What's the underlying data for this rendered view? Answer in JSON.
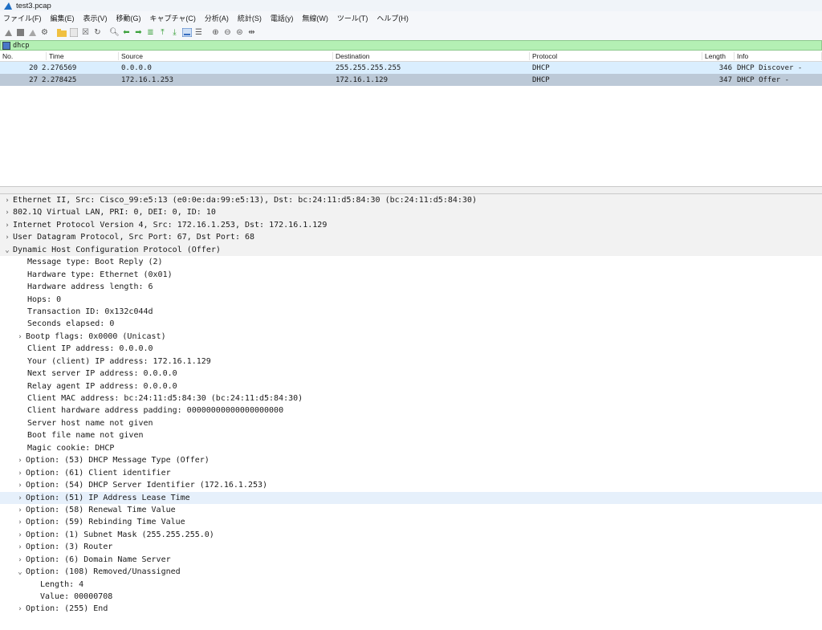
{
  "window": {
    "title": "test3.pcap"
  },
  "menu": [
    "ファイル(F)",
    "編集(E)",
    "表示(V)",
    "移動(G)",
    "キャプチャ(C)",
    "分析(A)",
    "統計(S)",
    "電話(y)",
    "無線(W)",
    "ツール(T)",
    "ヘルプ(H)"
  ],
  "filter": {
    "value": "dhcp"
  },
  "columns": {
    "no": "No.",
    "time": "Time",
    "source": "Source",
    "destination": "Destination",
    "protocol": "Protocol",
    "length": "Length",
    "info": "Info"
  },
  "packets": [
    {
      "no": "20",
      "time": "2.276569",
      "source": "0.0.0.0",
      "destination": "255.255.255.255",
      "protocol": "DHCP",
      "length": "346",
      "info": "DHCP Discover -"
    },
    {
      "no": "27",
      "time": "2.278425",
      "source": "172.16.1.253",
      "destination": "172.16.1.129",
      "protocol": "DHCP",
      "length": "347",
      "info": "DHCP Offer    -"
    }
  ],
  "details": [
    {
      "arrow": "›",
      "text": "Ethernet II, Src: Cisco_99:e5:13 (e0:0e:da:99:e5:13), Dst: bc:24:11:d5:84:30 (bc:24:11:d5:84:30)"
    },
    {
      "arrow": "›",
      "text": "802.1Q Virtual LAN, PRI: 0, DEI: 0, ID: 10"
    },
    {
      "arrow": "›",
      "text": "Internet Protocol Version 4, Src: 172.16.1.253, Dst: 172.16.1.129"
    },
    {
      "arrow": "›",
      "text": "User Datagram Protocol, Src Port: 67, Dst Port: 68"
    },
    {
      "arrow": "⌄",
      "text": "Dynamic Host Configuration Protocol (Offer)"
    },
    {
      "arrow": "",
      "text": "Message type: Boot Reply (2)"
    },
    {
      "arrow": "",
      "text": "Hardware type: Ethernet (0x01)"
    },
    {
      "arrow": "",
      "text": "Hardware address length: 6"
    },
    {
      "arrow": "",
      "text": "Hops: 0"
    },
    {
      "arrow": "",
      "text": "Transaction ID: 0x132c044d"
    },
    {
      "arrow": "",
      "text": "Seconds elapsed: 0"
    },
    {
      "arrow": "›",
      "text": "Bootp flags: 0x0000 (Unicast)"
    },
    {
      "arrow": "",
      "text": "Client IP address: 0.0.0.0"
    },
    {
      "arrow": "",
      "text": "Your (client) IP address: 172.16.1.129"
    },
    {
      "arrow": "",
      "text": "Next server IP address: 0.0.0.0"
    },
    {
      "arrow": "",
      "text": "Relay agent IP address: 0.0.0.0"
    },
    {
      "arrow": "",
      "text": "Client MAC address: bc:24:11:d5:84:30 (bc:24:11:d5:84:30)"
    },
    {
      "arrow": "",
      "text": "Client hardware address padding: 00000000000000000000"
    },
    {
      "arrow": "",
      "text": "Server host name not given"
    },
    {
      "arrow": "",
      "text": "Boot file name not given"
    },
    {
      "arrow": "",
      "text": "Magic cookie: DHCP"
    },
    {
      "arrow": "›",
      "text": "Option: (53) DHCP Message Type (Offer)"
    },
    {
      "arrow": "›",
      "text": "Option: (61) Client identifier"
    },
    {
      "arrow": "›",
      "text": "Option: (54) DHCP Server Identifier (172.16.1.253)"
    },
    {
      "arrow": "›",
      "text": "Option: (51) IP Address Lease Time"
    },
    {
      "arrow": "›",
      "text": "Option: (58) Renewal Time Value"
    },
    {
      "arrow": "›",
      "text": "Option: (59) Rebinding Time Value"
    },
    {
      "arrow": "›",
      "text": "Option: (1) Subnet Mask (255.255.255.0)"
    },
    {
      "arrow": "›",
      "text": "Option: (3) Router"
    },
    {
      "arrow": "›",
      "text": "Option: (6) Domain Name Server"
    },
    {
      "arrow": "⌄",
      "text": "Option: (108) Removed/Unassigned"
    },
    {
      "arrow": "",
      "text": "Length: 4"
    },
    {
      "arrow": "",
      "text": "Value: 00000708"
    },
    {
      "arrow": "›",
      "text": "Option: (255) End"
    }
  ],
  "icons": [
    "shark-fin-start",
    "stop-square",
    "restart-fin",
    "options-gear",
    "open-folder",
    "save-file",
    "close-file",
    "reload",
    "search",
    "go-back",
    "go-forward",
    "go-to-packet",
    "go-first",
    "go-last",
    "autoscroll",
    "colorize",
    "zoom-in",
    "zoom-out",
    "zoom-normal",
    "resize-columns"
  ]
}
